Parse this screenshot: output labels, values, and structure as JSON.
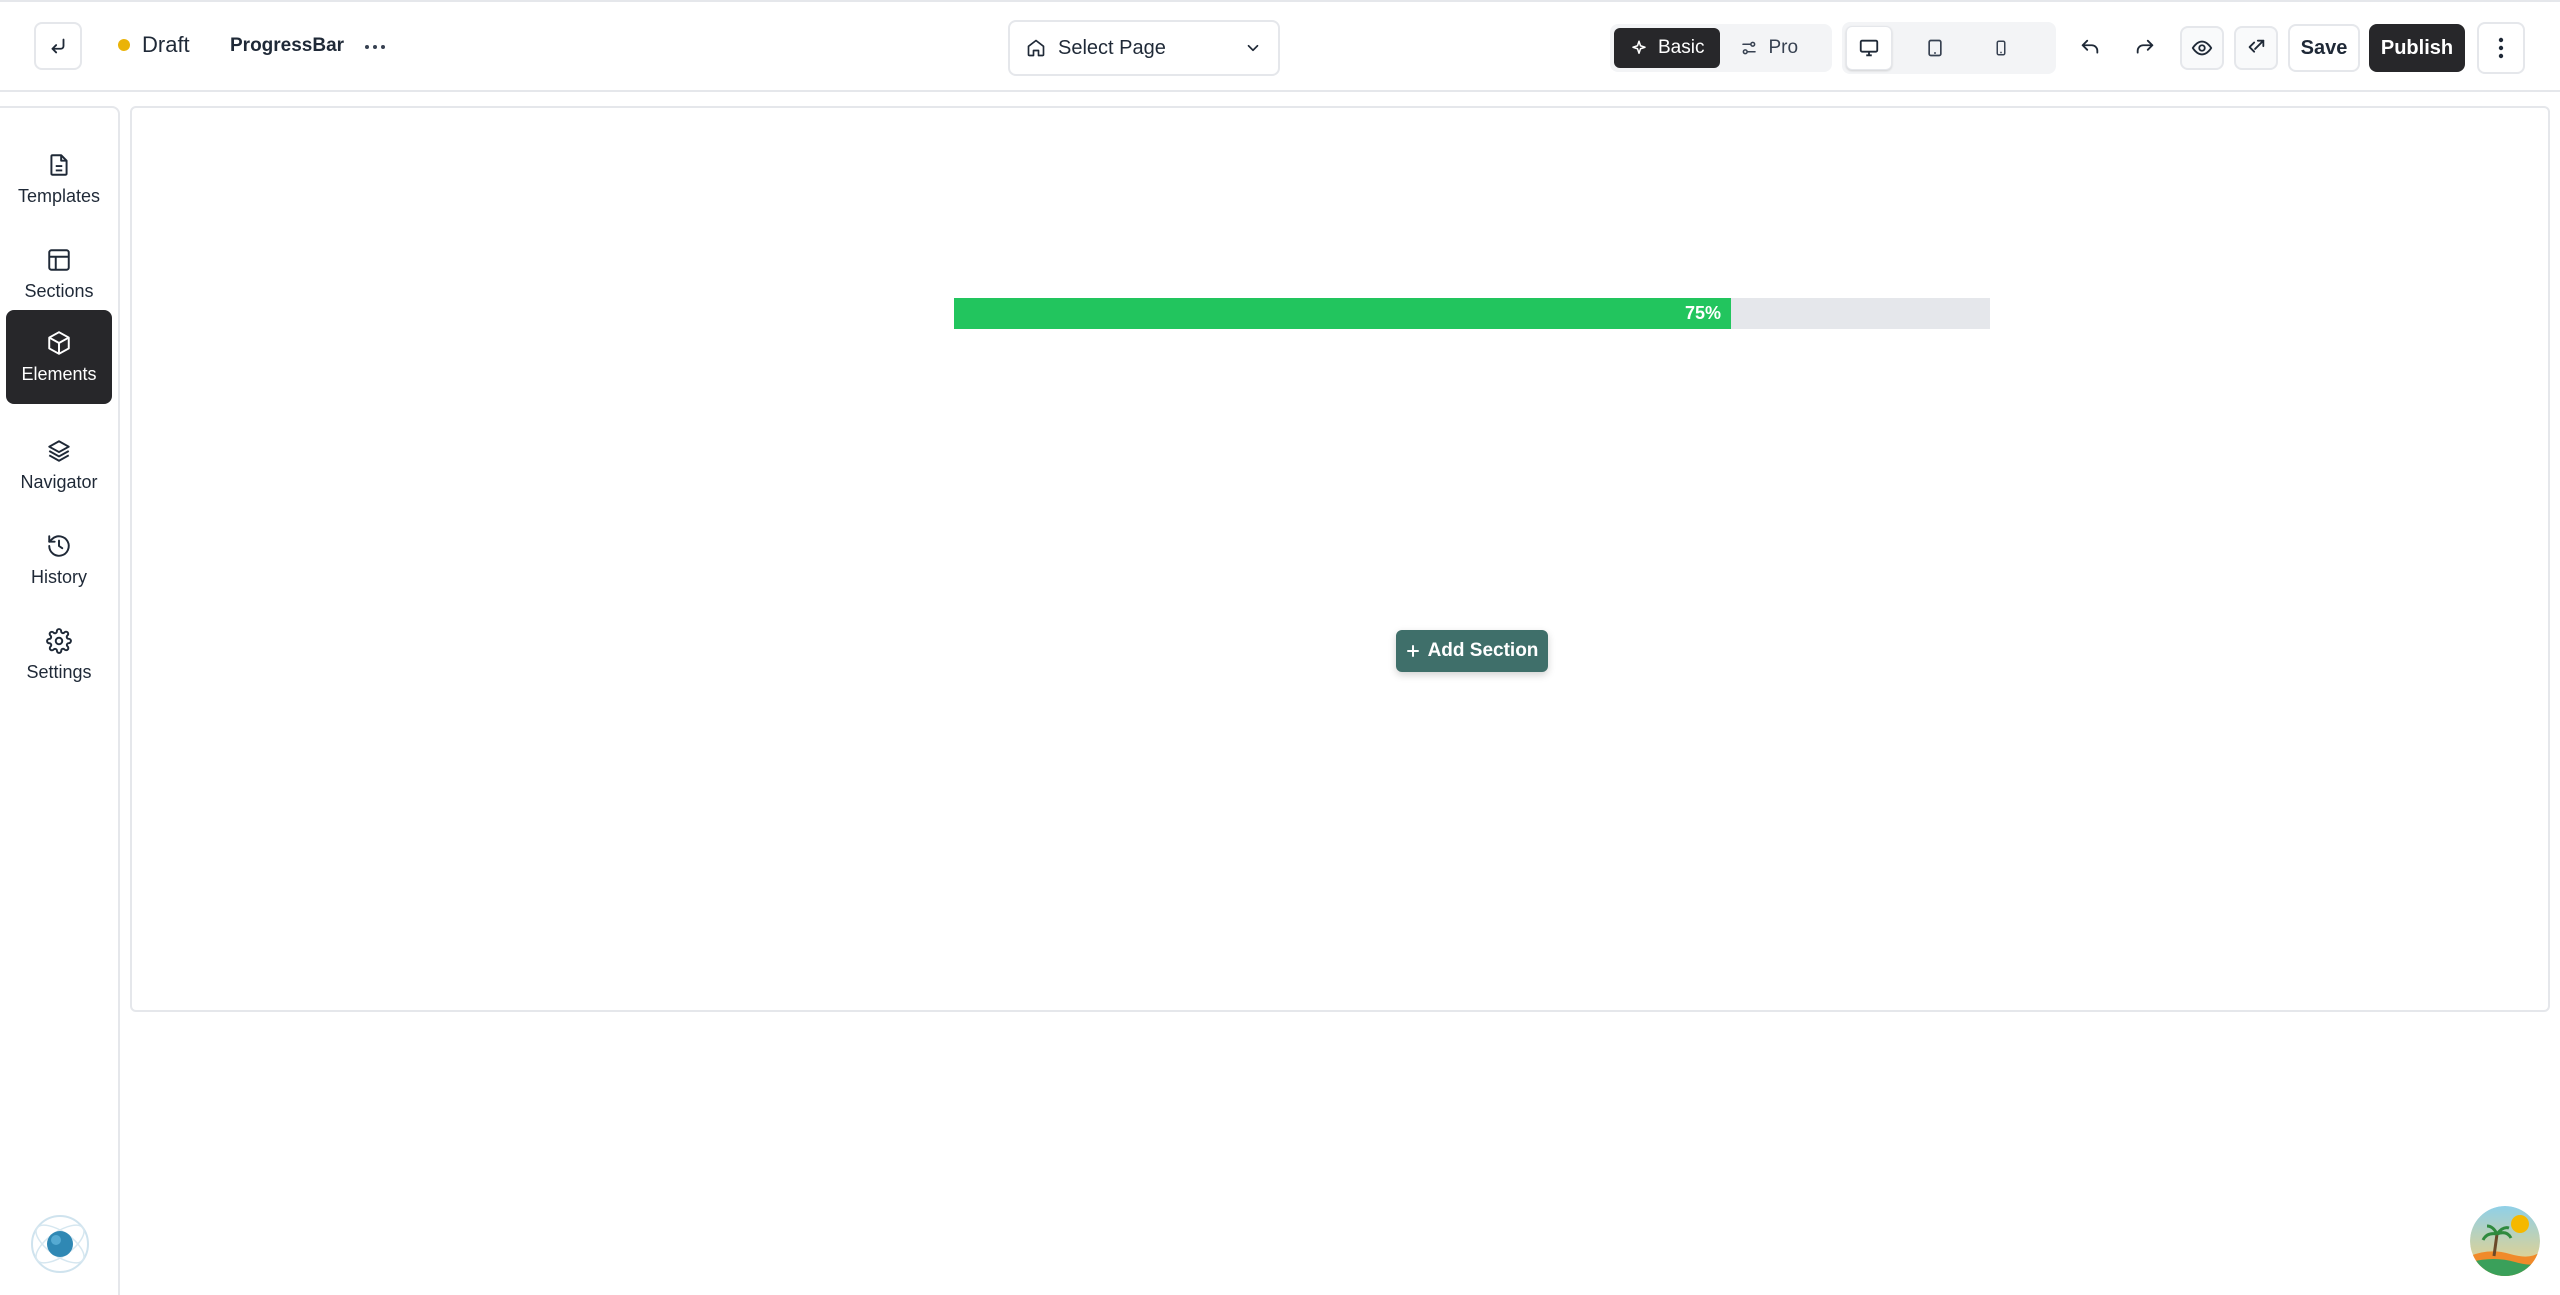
{
  "header": {
    "status_label": "Draft",
    "status_color": "#eab308",
    "page_name": "ProgressBar",
    "select_page_label": "Select Page",
    "mode_basic_label": "Basic",
    "mode_pro_label": "Pro",
    "active_mode": "Basic",
    "active_device": "desktop",
    "save_label": "Save",
    "publish_label": "Publish"
  },
  "sidebar": {
    "items": [
      {
        "label": "Templates",
        "icon": "file-icon"
      },
      {
        "label": "Sections",
        "icon": "layout-icon"
      },
      {
        "label": "Elements",
        "icon": "cube-icon",
        "active": true
      },
      {
        "label": "Navigator",
        "icon": "layers-icon"
      },
      {
        "label": "History",
        "icon": "history-icon"
      },
      {
        "label": "Settings",
        "icon": "gear-icon"
      }
    ]
  },
  "canvas": {
    "progress": {
      "value_percent": 75,
      "label": "75%",
      "fill_color": "#22c55e",
      "track_color": "#e5e7eb"
    },
    "add_section_label": "Add Section",
    "add_section_color": "#3f6f6a"
  }
}
